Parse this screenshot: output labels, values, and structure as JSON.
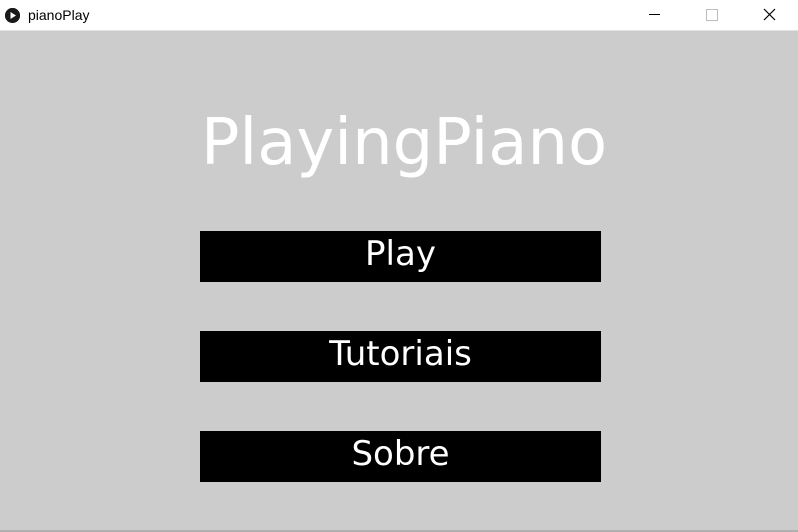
{
  "window": {
    "title": "pianoPlay",
    "app_icon": "play-circle-icon",
    "controls": [
      "minimize-icon",
      "maximize-icon",
      "close-icon"
    ]
  },
  "main": {
    "title": "PlayingPiano",
    "buttons": {
      "play": "Play",
      "tutoriais": "Tutoriais",
      "sobre": "Sobre"
    }
  },
  "colors": {
    "background": "#cccccc",
    "button_background": "#000000",
    "button_text": "#ffffff",
    "title_text": "#ffffff"
  }
}
